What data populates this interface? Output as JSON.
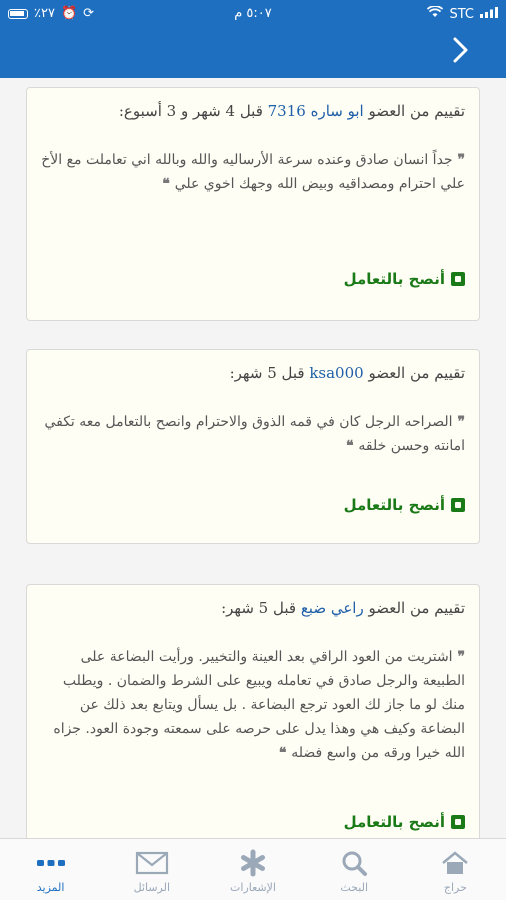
{
  "status_bar": {
    "battery_left": "٪٢٧",
    "time": "٥:٠٧ م",
    "carrier": "STC"
  },
  "reviews": [
    {
      "prefix": "تقييم من العضو ",
      "member": "ابو ساره 7316",
      "suffix": " قبل 4 شهر و 3 أسبوع:",
      "body": "جداً انسان صادق وعنده سرعة الأرساليه والله وبالله اني تعاملت مع الأخ علي احترام ومصداقيه وبيض الله وجهك اخوي علي",
      "recommend": "أنصح بالتعامل"
    },
    {
      "prefix": "تقييم من العضو ",
      "member": "ksa000",
      "suffix": " قبل 5 شهر:",
      "body": "الصراحه الرجل كان في قمه الذوق والاحترام وانصح بالتعامل معه تكفي امانته وحسن خلقه",
      "recommend": "أنصح بالتعامل"
    },
    {
      "prefix": "تقييم من العضو ",
      "member": "راعي ضبع",
      "suffix": " قبل 5 شهر:",
      "body": "اشتريت من العود الراقي بعد العينة والتخيير. ورأيت البضاعة على الطبيعة والرجل صادق في تعامله ويبيع على الشرط والضمان . ويطلب منك لو ما جاز لك العود ترجع البضاعة . بل يسأل ويتابع بعد ذلك عن البضاعة وكيف هي وهذا يدل على حرصه على سمعته وجودة العود. جزاه الله خيرا ورقه من واسع فضله",
      "recommend": "أنصح بالتعامل"
    }
  ],
  "tabs": [
    {
      "label": "حراج",
      "icon": "home-icon"
    },
    {
      "label": "البحث",
      "icon": "search-icon"
    },
    {
      "label": "الإشعارات",
      "icon": "asterisk-icon"
    },
    {
      "label": "الرسائل",
      "icon": "envelope-icon"
    },
    {
      "label": "المزيد",
      "icon": "more-dots-icon"
    }
  ],
  "colors": {
    "brand_blue": "#1f6fc0",
    "recommend_green": "#1a7a17",
    "card_bg": "#fffef4"
  }
}
